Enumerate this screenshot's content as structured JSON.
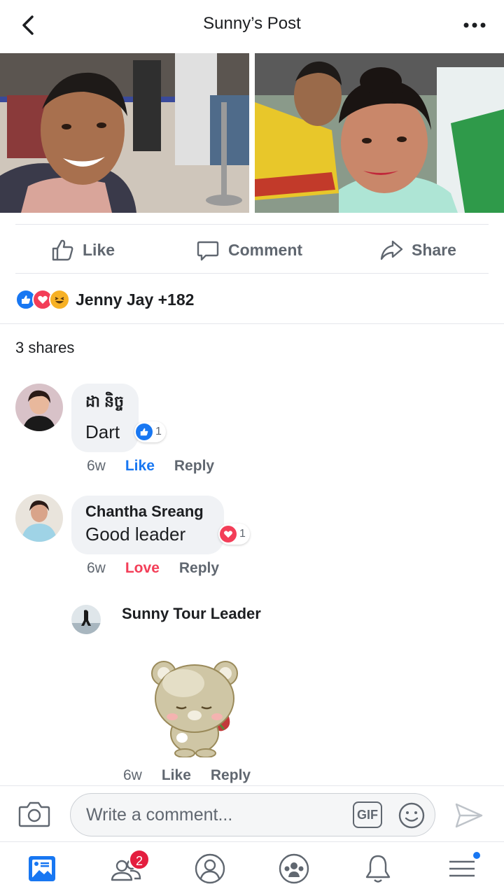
{
  "header": {
    "title": "Sunny’s Post"
  },
  "actions": {
    "like": "Like",
    "comment": "Comment",
    "share": "Share"
  },
  "reactions": {
    "names": "Jenny Jay +182"
  },
  "shares": "3 shares",
  "comments": [
    {
      "author": "ដា និច្ច",
      "text": "Dart",
      "time": "6w",
      "like": "Like",
      "reply": "Reply",
      "reaction_count": "1",
      "reaction": "like"
    },
    {
      "author": "Chantha Sreang",
      "text": "Good leader",
      "time": "6w",
      "like": "Love",
      "reply": "Reply",
      "reaction_count": "1",
      "reaction": "love"
    }
  ],
  "reply": {
    "author": "Sunny Tour Leader",
    "time": "6w",
    "like": "Like",
    "reply": "Reply"
  },
  "comment_bar": {
    "placeholder": "Write a comment...",
    "gif": "GIF"
  },
  "tabbar": {
    "friends_badge": "2"
  },
  "colors": {
    "accent": "#1877f2",
    "love": "#f33e58",
    "text_secondary": "#606770"
  }
}
